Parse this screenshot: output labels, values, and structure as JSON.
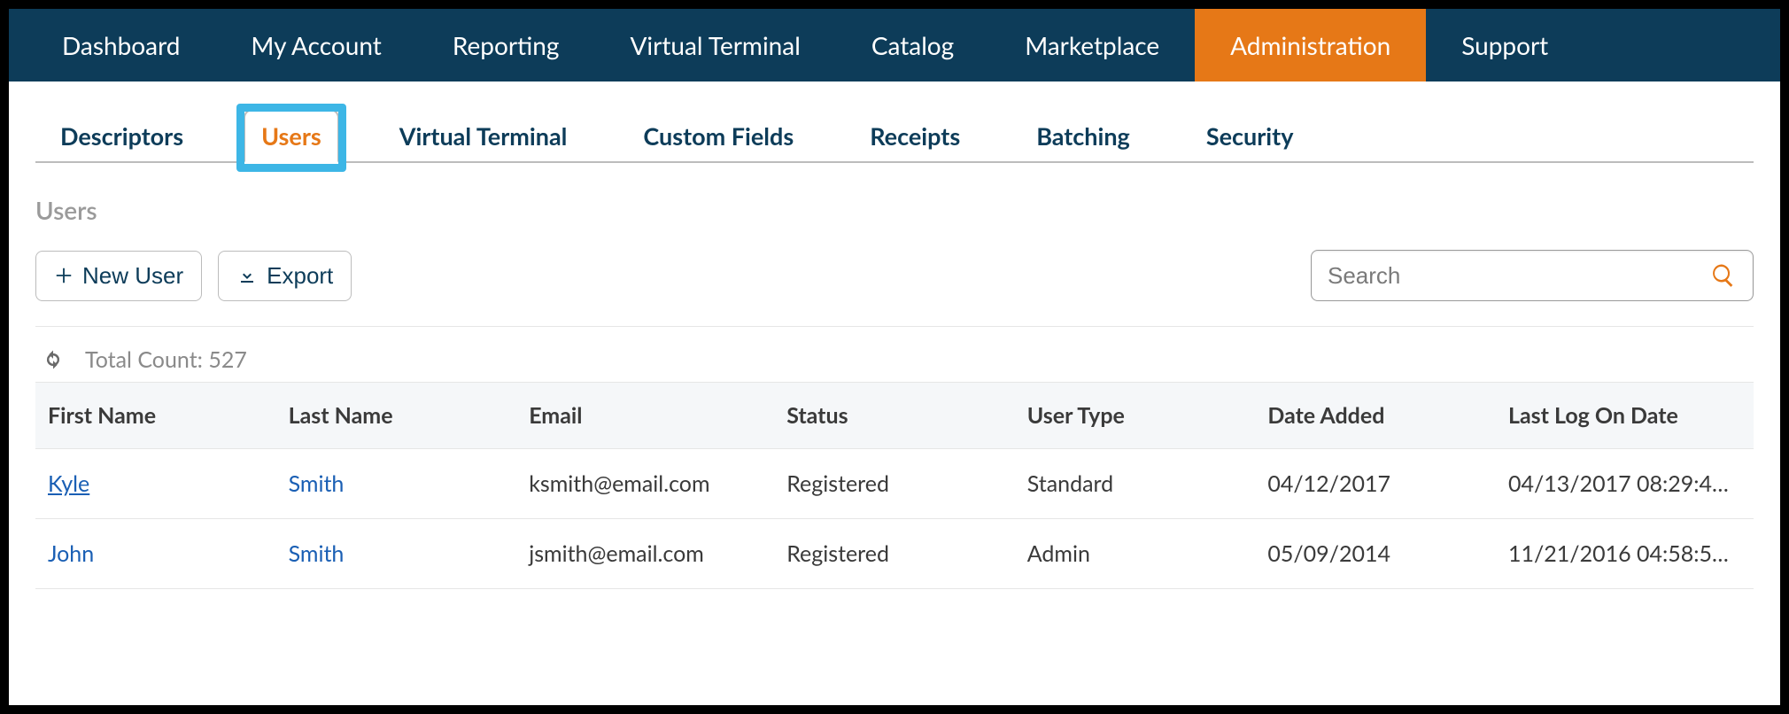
{
  "topnav": {
    "items": [
      {
        "label": "Dashboard"
      },
      {
        "label": "My Account"
      },
      {
        "label": "Reporting"
      },
      {
        "label": "Virtual Terminal"
      },
      {
        "label": "Catalog"
      },
      {
        "label": "Marketplace"
      },
      {
        "label": "Administration",
        "active": true
      },
      {
        "label": "Support"
      }
    ]
  },
  "subtabs": {
    "items": [
      {
        "label": "Descriptors"
      },
      {
        "label": "Users",
        "active": true,
        "highlighted": true
      },
      {
        "label": "Virtual Terminal"
      },
      {
        "label": "Custom Fields"
      },
      {
        "label": "Receipts"
      },
      {
        "label": "Batching"
      },
      {
        "label": "Security"
      }
    ]
  },
  "page": {
    "title": "Users"
  },
  "toolbar": {
    "newUserLabel": "New User",
    "exportLabel": "Export",
    "searchPlaceholder": "Search"
  },
  "count": {
    "label": "Total Count:",
    "value": "527"
  },
  "table": {
    "headers": {
      "first": "First Name",
      "last": "Last Name",
      "email": "Email",
      "status": "Status",
      "type": "User Type",
      "added": "Date Added",
      "logon": "Last Log On Date"
    },
    "rows": [
      {
        "first": "Kyle",
        "firstUnderline": true,
        "last": "Smith",
        "email": "ksmith@email.com",
        "status": "Registered",
        "type": "Standard",
        "added": "04/12/2017",
        "logon": "04/13/2017 08:29:4…"
      },
      {
        "first": "John",
        "firstUnderline": false,
        "last": "Smith",
        "email": "jsmith@email.com",
        "status": "Registered",
        "type": "Admin",
        "added": "05/09/2014",
        "logon": "11/21/2016 04:58:5…"
      }
    ]
  }
}
